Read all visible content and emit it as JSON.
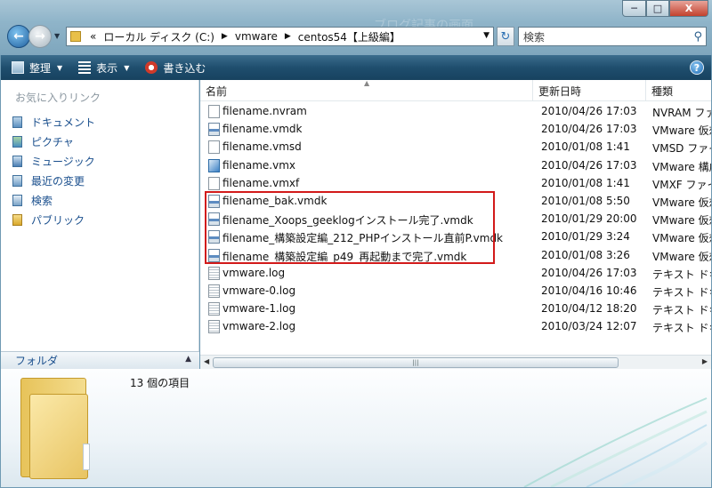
{
  "window": {
    "ghost_title": "ブログ記事の画面",
    "min_label": "─",
    "max_label": "□",
    "close_label": "X"
  },
  "nav": {
    "back_label": "←",
    "fwd_label": "→",
    "history_label": "▼"
  },
  "address": {
    "prefix": "«",
    "segments": [
      "ローカル ディスク (C:)",
      "vmware",
      "centos54【上級編】"
    ],
    "separator": "▶",
    "dropdown": "▼"
  },
  "refresh_label": "↻",
  "search": {
    "placeholder": "検索",
    "icon_label": "⚲"
  },
  "toolbar": {
    "organize": "整理",
    "view": "表示",
    "burn": "書き込む",
    "dropdown_arrow": "▼",
    "help": "?"
  },
  "sidebar": {
    "title": "お気に入りリンク",
    "items": [
      {
        "label": "ドキュメント",
        "icon": "documents-icon"
      },
      {
        "label": "ピクチャ",
        "icon": "pictures-icon"
      },
      {
        "label": "ミュージック",
        "icon": "music-icon"
      },
      {
        "label": "最近の変更",
        "icon": "recent-changes-icon"
      },
      {
        "label": "検索",
        "icon": "searches-icon"
      },
      {
        "label": "パブリック",
        "icon": "public-folder-icon"
      }
    ],
    "folder_header": "フォルダ",
    "folder_toggle": "▲"
  },
  "columns": {
    "name": "名前",
    "date": "更新日時",
    "type": "種類",
    "sort": "▲"
  },
  "files": [
    {
      "name": "filename.nvram",
      "date": "2010/04/26 17:03",
      "type": "NVRAM ファ",
      "icon": "file"
    },
    {
      "name": "filename.vmdk",
      "date": "2010/04/26 17:03",
      "type": "VMware 仮想",
      "icon": "disk"
    },
    {
      "name": "filename.vmsd",
      "date": "2010/01/08 1:41",
      "type": "VMSD ファイ",
      "icon": "file"
    },
    {
      "name": "filename.vmx",
      "date": "2010/04/26 17:03",
      "type": "VMware 構成",
      "icon": "vmx"
    },
    {
      "name": "filename.vmxf",
      "date": "2010/01/08 1:41",
      "type": "VMXF ファイ",
      "icon": "file"
    },
    {
      "name": "filename_bak.vmdk",
      "date": "2010/01/08 5:50",
      "type": "VMware 仮想",
      "icon": "disk"
    },
    {
      "name": "filename_Xoops_geeklogインストール完了.vmdk",
      "date": "2010/01/29 20:00",
      "type": "VMware 仮想",
      "icon": "disk"
    },
    {
      "name": "filename_構築設定編_212_PHPインストール直前P.vmdk",
      "date": "2010/01/29 3:24",
      "type": "VMware 仮想",
      "icon": "disk"
    },
    {
      "name": "filename_構築設定編_p49_再起動まで完了.vmdk",
      "date": "2010/01/08 3:26",
      "type": "VMware 仮想",
      "icon": "disk"
    },
    {
      "name": "vmware.log",
      "date": "2010/04/26 17:03",
      "type": "テキスト ドキ",
      "icon": "log"
    },
    {
      "name": "vmware-0.log",
      "date": "2010/04/16 10:46",
      "type": "テキスト ドキ",
      "icon": "log"
    },
    {
      "name": "vmware-1.log",
      "date": "2010/04/12 18:20",
      "type": "テキスト ドキ",
      "icon": "log"
    },
    {
      "name": "vmware-2.log",
      "date": "2010/03/24 12:07",
      "type": "テキスト ドキ",
      "icon": "log"
    }
  ],
  "scroll": {
    "left": "◀",
    "right": "▶",
    "grip": "|||"
  },
  "details": {
    "count": "13 個の項目"
  }
}
